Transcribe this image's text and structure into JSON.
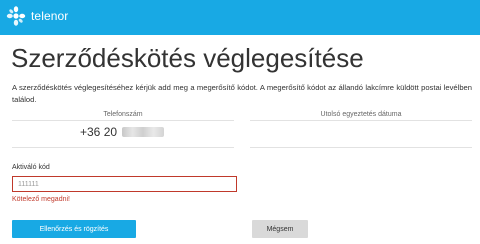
{
  "brand": {
    "name": "telenor",
    "color": "#18a9e4",
    "icon": "telenor-logo-icon"
  },
  "page": {
    "title": "Szerződéskötés véglegesítése",
    "intro": "A szerződéskötés véglegesítéséhez kérjük add meg a megerősítő kódot. A megerősítő kódot az állandó lakcímre küldött postai levélben találod."
  },
  "phone_panel": {
    "label": "Telefonszám",
    "value": "+36 20"
  },
  "date_panel": {
    "label": "Utolsó egyeztetés dátuma",
    "value": ""
  },
  "activation": {
    "label": "Aktiváló kód",
    "placeholder": "111111",
    "value": "",
    "error": "Kötelező megadni!",
    "error_color": "#c0392b"
  },
  "buttons": {
    "submit": "Ellenőrzés és rögzítés",
    "cancel": "Mégsem"
  }
}
